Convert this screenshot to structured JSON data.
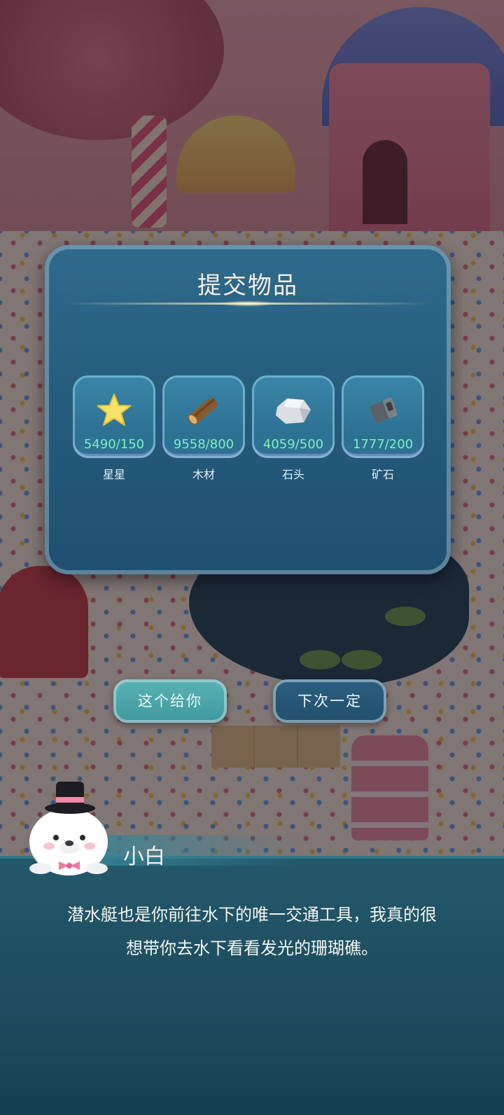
{
  "dialog": {
    "title": "提交物品",
    "items": [
      {
        "icon": "star-icon",
        "count": "5490/150",
        "name": "星星"
      },
      {
        "icon": "wood-log-icon",
        "count": "9558/800",
        "name": "木材"
      },
      {
        "icon": "stone-icon",
        "count": "4059/500",
        "name": "石头"
      },
      {
        "icon": "ore-icon",
        "count": "1777/200",
        "name": "矿石"
      }
    ]
  },
  "buttons": {
    "give_label": "这个给你",
    "decline_label": "下次一定"
  },
  "speaker": {
    "name": "小白",
    "avatar_icon": "seal-with-top-hat-icon",
    "text_line1": "潜水艇也是你前往水下的唯一交通工具，我真的很",
    "text_line2": "想带你去水下看看发光的珊瑚礁。"
  },
  "colors": {
    "panel": "#2f6a8c",
    "count_text": "#7ef0bf",
    "give_button": "#5ab4b6",
    "decline_button": "#2a5e80",
    "dialog_box": "#22586a"
  }
}
